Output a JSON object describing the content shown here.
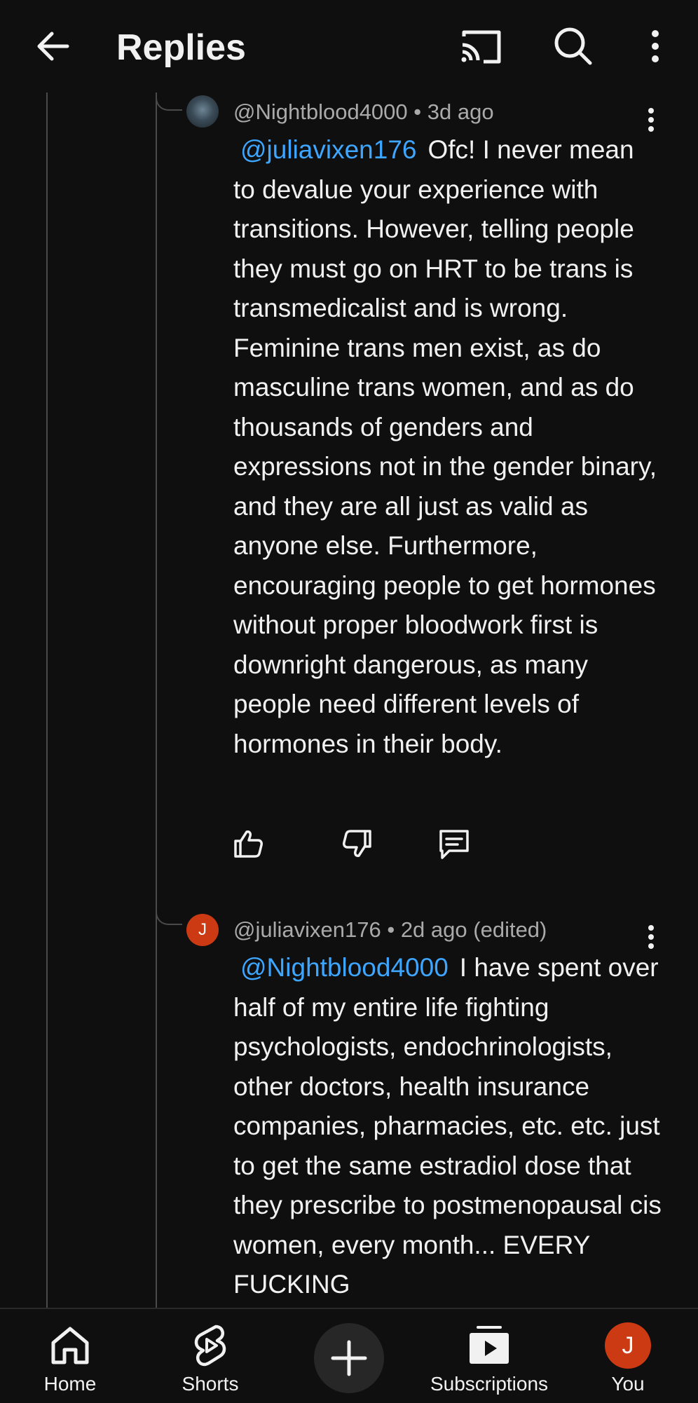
{
  "header": {
    "title": "Replies"
  },
  "comments": [
    {
      "handle": "@Nightblood4000",
      "separator": "•",
      "time": "3d ago",
      "edited": "",
      "avatar_letter": "",
      "mention": "@juliavixen176",
      "text": "Ofc! I never mean to devalue your experience with transitions. However, telling people they must go on HRT to be trans is transmedicalist and is wrong. Feminine trans men exist, as do masculine trans women, and as do thousands of genders and expressions not in the gender binary, and they are all just as valid as anyone else. Furthermore, encouraging people to get hormones without proper bloodwork first is downright dangerous, as many people need different levels of hormones in their body."
    },
    {
      "handle": "@juliavixen176",
      "separator": "•",
      "time": "2d ago",
      "edited": "(edited)",
      "avatar_letter": "J",
      "mention": "@Nightblood4000",
      "text": "I have spent over half of my entire life fighting psychologists, endochrinologists, other doctors, health insurance companies, pharmacies, etc. etc. just to get the same estradiol dose that they prescribe to postmenopausal cis women, every month... EVERY FUCKING"
    }
  ],
  "bottom_nav": {
    "home": "Home",
    "shorts": "Shorts",
    "subscriptions": "Subscriptions",
    "you": "You",
    "you_avatar_letter": "J"
  },
  "colors": {
    "background": "#0f0f0f",
    "mention": "#3ea6ff",
    "secondary_text": "#aaaaaa",
    "avatar_accent": "#cc3a14"
  },
  "icons": {
    "back": "arrow-left-icon",
    "cast": "cast-icon",
    "search": "search-icon",
    "more": "more-vertical-icon",
    "like": "thumbs-up-icon",
    "dislike": "thumbs-down-icon",
    "reply": "comment-icon",
    "home": "home-icon",
    "shorts": "shorts-icon",
    "create": "plus-icon",
    "subscriptions": "subscriptions-icon"
  }
}
